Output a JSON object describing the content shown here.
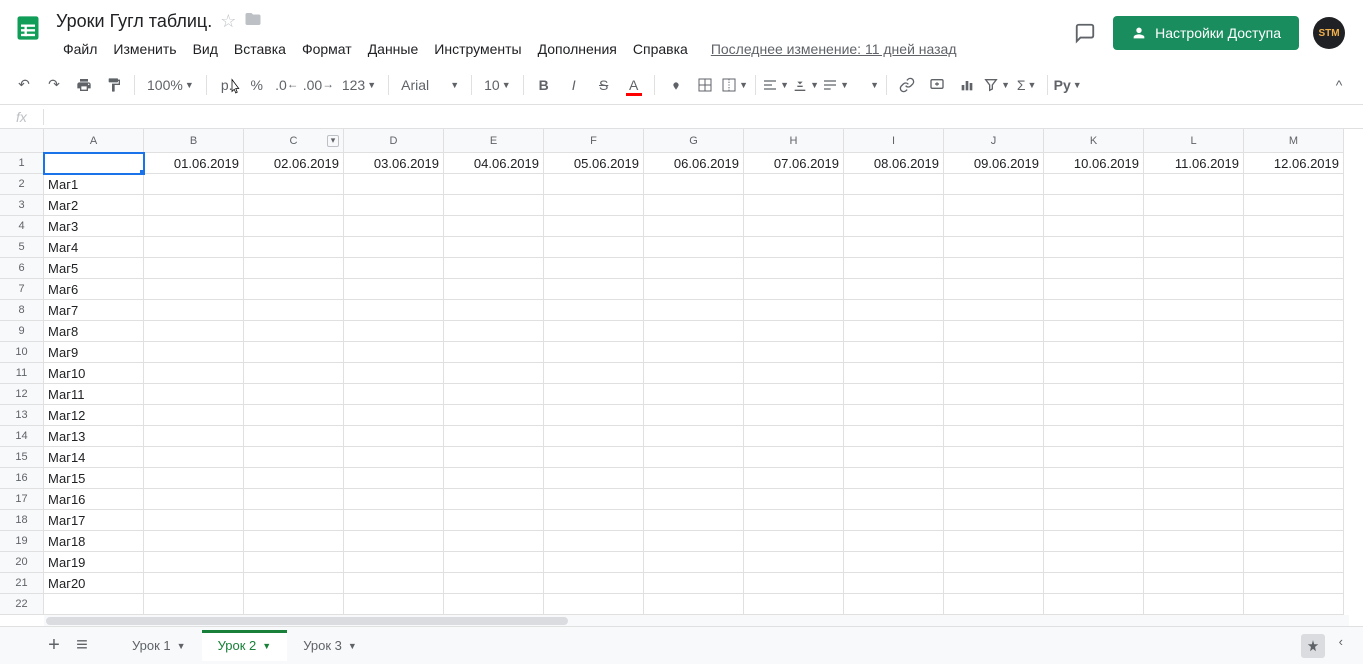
{
  "doc": {
    "title": "Уроки Гугл таблиц."
  },
  "menu": [
    "Файл",
    "Изменить",
    "Вид",
    "Вставка",
    "Формат",
    "Данные",
    "Инструменты",
    "Дополнения",
    "Справка"
  ],
  "last_edit": "Последнее изменение: 11 дней назад",
  "share_label": "Настройки Доступа",
  "avatar_text": "STM",
  "toolbar": {
    "zoom": "100%",
    "currency": "р.",
    "percent": "%",
    "dec_dec": ".0",
    "inc_dec": ".00",
    "numfmt": "123",
    "font": "Arial",
    "font_size": "10"
  },
  "fx": {
    "label": "fx",
    "value": ""
  },
  "columns": [
    "A",
    "B",
    "C",
    "D",
    "E",
    "F",
    "G",
    "H",
    "I",
    "J",
    "K",
    "L",
    "M"
  ],
  "filtered_col_index": 2,
  "row_numbers": [
    1,
    2,
    3,
    4,
    5,
    6,
    7,
    8,
    9,
    10,
    11,
    12,
    13,
    14,
    15,
    16,
    17,
    18,
    19,
    20,
    21,
    22
  ],
  "dates": [
    "01.06.2019",
    "02.06.2019",
    "03.06.2019",
    "04.06.2019",
    "05.06.2019",
    "06.06.2019",
    "07.06.2019",
    "08.06.2019",
    "09.06.2019",
    "10.06.2019",
    "11.06.2019",
    "12.06.2019"
  ],
  "row_labels": [
    "Маг1",
    "Маг2",
    "Маг3",
    "Маг4",
    "Маг5",
    "Маг6",
    "Маг7",
    "Маг8",
    "Маг9",
    "Маг10",
    "Маг11",
    "Маг12",
    "Маг13",
    "Маг14",
    "Маг15",
    "Маг16",
    "Маг17",
    "Маг18",
    "Маг19",
    "Маг20"
  ],
  "sheets": [
    {
      "name": "Урок 1",
      "active": false
    },
    {
      "name": "Урок 2",
      "active": true
    },
    {
      "name": "Урок 3",
      "active": false
    }
  ]
}
